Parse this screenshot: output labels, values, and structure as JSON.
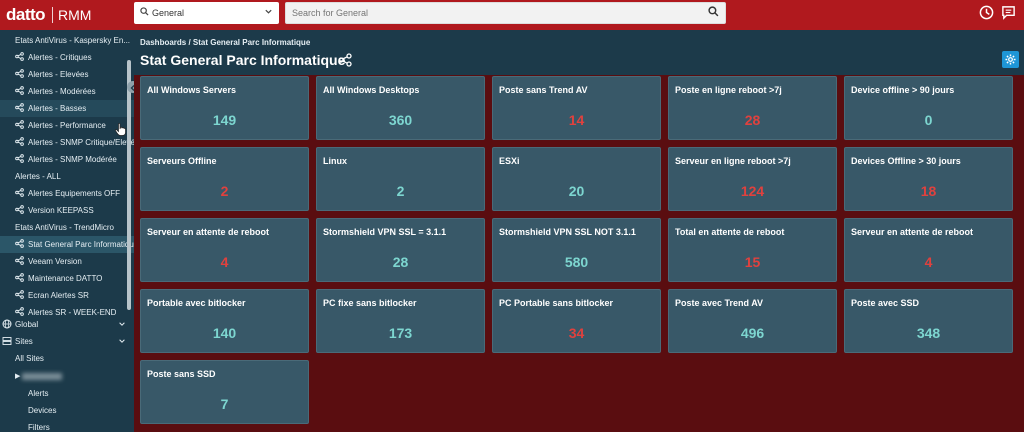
{
  "header": {
    "logo": "datto",
    "product": "RMM",
    "scope_value": "General",
    "search_placeholder": "Search for General"
  },
  "sidebar": {
    "items": [
      {
        "label": "Etats AntiVirus - Kaspersky En...",
        "kind": "plain"
      },
      {
        "label": "Alertes - Critiques",
        "kind": "link"
      },
      {
        "label": "Alertes - Elevées",
        "kind": "link"
      },
      {
        "label": "Alertes - Modérées",
        "kind": "link"
      },
      {
        "label": "Alertes - Basses",
        "kind": "link",
        "hover": true
      },
      {
        "label": "Alertes - Performance",
        "kind": "link"
      },
      {
        "label": "Alertes - SNMP Critique/Elevée",
        "kind": "link"
      },
      {
        "label": "Alertes - SNMP Modérée",
        "kind": "link"
      },
      {
        "label": "Alertes - ALL",
        "kind": "plain"
      },
      {
        "label": "Alertes Equipements OFF",
        "kind": "link"
      },
      {
        "label": "Version KEEPASS",
        "kind": "link"
      },
      {
        "label": "Etats AntiVirus - TrendMicro",
        "kind": "plain"
      },
      {
        "label": "Stat General Parc Informatique",
        "kind": "link",
        "active": true
      },
      {
        "label": "Veeam Version",
        "kind": "link"
      },
      {
        "label": "Maintenance DATTO",
        "kind": "link"
      },
      {
        "label": "Ecran Alertes SR",
        "kind": "link"
      },
      {
        "label": "Alertes SR - WEEK-END",
        "kind": "link"
      }
    ],
    "global_label": "Global",
    "sites_label": "Sites",
    "all_sites_label": "All Sites",
    "alerts_label": "Alerts",
    "devices_label": "Devices",
    "filters_label": "Filters"
  },
  "main": {
    "breadcrumb": "Dashboards / Stat General Parc Informatique",
    "title": "Stat General Parc Informatique",
    "tiles": [
      {
        "title": "All Windows Servers",
        "value": "149",
        "color": "#7dd6d0"
      },
      {
        "title": "All Windows Desktops",
        "value": "360",
        "color": "#7dd6d0"
      },
      {
        "title": "Poste sans Trend AV",
        "value": "14",
        "color": "#e0413e"
      },
      {
        "title": "Poste en ligne reboot >7j",
        "value": "28",
        "color": "#e0413e"
      },
      {
        "title": "Device offline > 90 jours",
        "value": "0",
        "color": "#7dd6d0"
      },
      {
        "title": "Serveurs Offline",
        "value": "2",
        "color": "#e0413e"
      },
      {
        "title": "Linux",
        "value": "2",
        "color": "#7dd6d0"
      },
      {
        "title": "ESXi",
        "value": "20",
        "color": "#7dd6d0"
      },
      {
        "title": "Serveur en ligne reboot >7j",
        "value": "124",
        "color": "#e0413e"
      },
      {
        "title": "Devices Offline > 30 jours",
        "value": "18",
        "color": "#e0413e"
      },
      {
        "title": "Serveur en attente de reboot",
        "value": "4",
        "color": "#e0413e"
      },
      {
        "title": "Stormshield VPN SSL = 3.1.1",
        "value": "28",
        "color": "#7dd6d0"
      },
      {
        "title": "Stormshield VPN SSL NOT 3.1.1",
        "value": "580",
        "color": "#7dd6d0"
      },
      {
        "title": "Total en attente de reboot",
        "value": "15",
        "color": "#e0413e"
      },
      {
        "title": "Serveur en attente de reboot",
        "value": "4",
        "color": "#e0413e"
      },
      {
        "title": "Portable avec bitlocker",
        "value": "140",
        "color": "#7dd6d0"
      },
      {
        "title": "PC fixe sans bitlocker",
        "value": "173",
        "color": "#7dd6d0"
      },
      {
        "title": "PC Portable sans bitlocker",
        "value": "34",
        "color": "#e0413e"
      },
      {
        "title": "Poste avec Trend AV",
        "value": "496",
        "color": "#7dd6d0"
      },
      {
        "title": "Poste avec SSD",
        "value": "348",
        "color": "#7dd6d0"
      },
      {
        "title": "Poste sans SSD",
        "value": "7",
        "color": "#7dd6d0"
      }
    ]
  }
}
